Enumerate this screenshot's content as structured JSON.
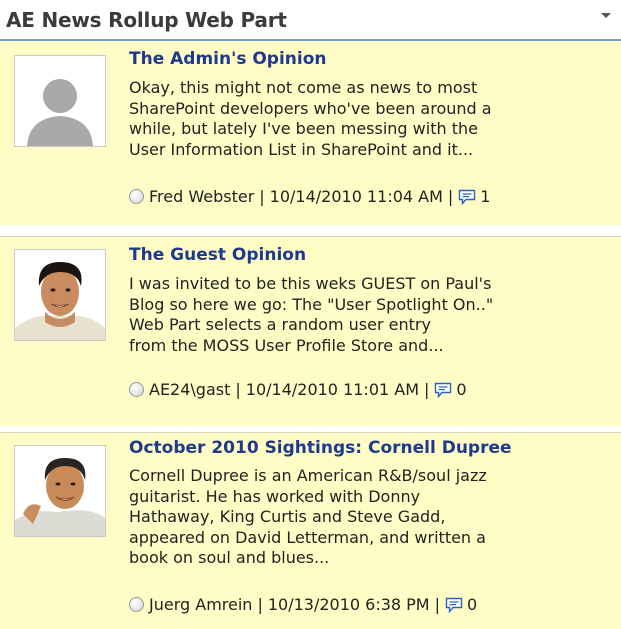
{
  "webpart": {
    "title": "AE News Rollup Web Part",
    "menu_icon": "dropdown-arrow"
  },
  "items": [
    {
      "title": "The Admin's Opinion",
      "body_lines": [
        "Okay, this might not come as news to most",
        "SharePoint developers who've been around a",
        "while, but lately I've been messing with the",
        "User Information List in SharePoint and it..."
      ],
      "author": "Fred Webster",
      "date": "10/14/2010 11:04 AM",
      "comments": "1",
      "thumbnail": "placeholder-person"
    },
    {
      "title": "The Guest Opinion",
      "body_lines": [
        "I was invited to be this weks GUEST on Paul's",
        "Blog so here we go: The \"User Spotlight On..\"",
        "Web Part selects a random user entry",
        "from the MOSS User Profile Store and..."
      ],
      "author": "AE24\\gast",
      "date": "10/14/2010 11:01 AM",
      "comments": "0",
      "thumbnail": "user-photo"
    },
    {
      "title": "October 2010 Sightings: Cornell Dupree",
      "body_lines": [
        "Cornell Dupree is an American R&B/soul jazz",
        "guitarist. He has worked with Donny",
        "Hathaway, King Curtis and Steve Gadd,",
        "appeared on David Letterman, and written a",
        "book on soul and blues..."
      ],
      "author": "Juerg Amrein",
      "date": "10/13/2010 6:38 PM",
      "comments": "0",
      "thumbnail": "user-photo"
    }
  ],
  "colors": {
    "item_background": "#fffdc5",
    "title_text": "#1f3a8c",
    "header_rule": "#7a9cc9"
  }
}
